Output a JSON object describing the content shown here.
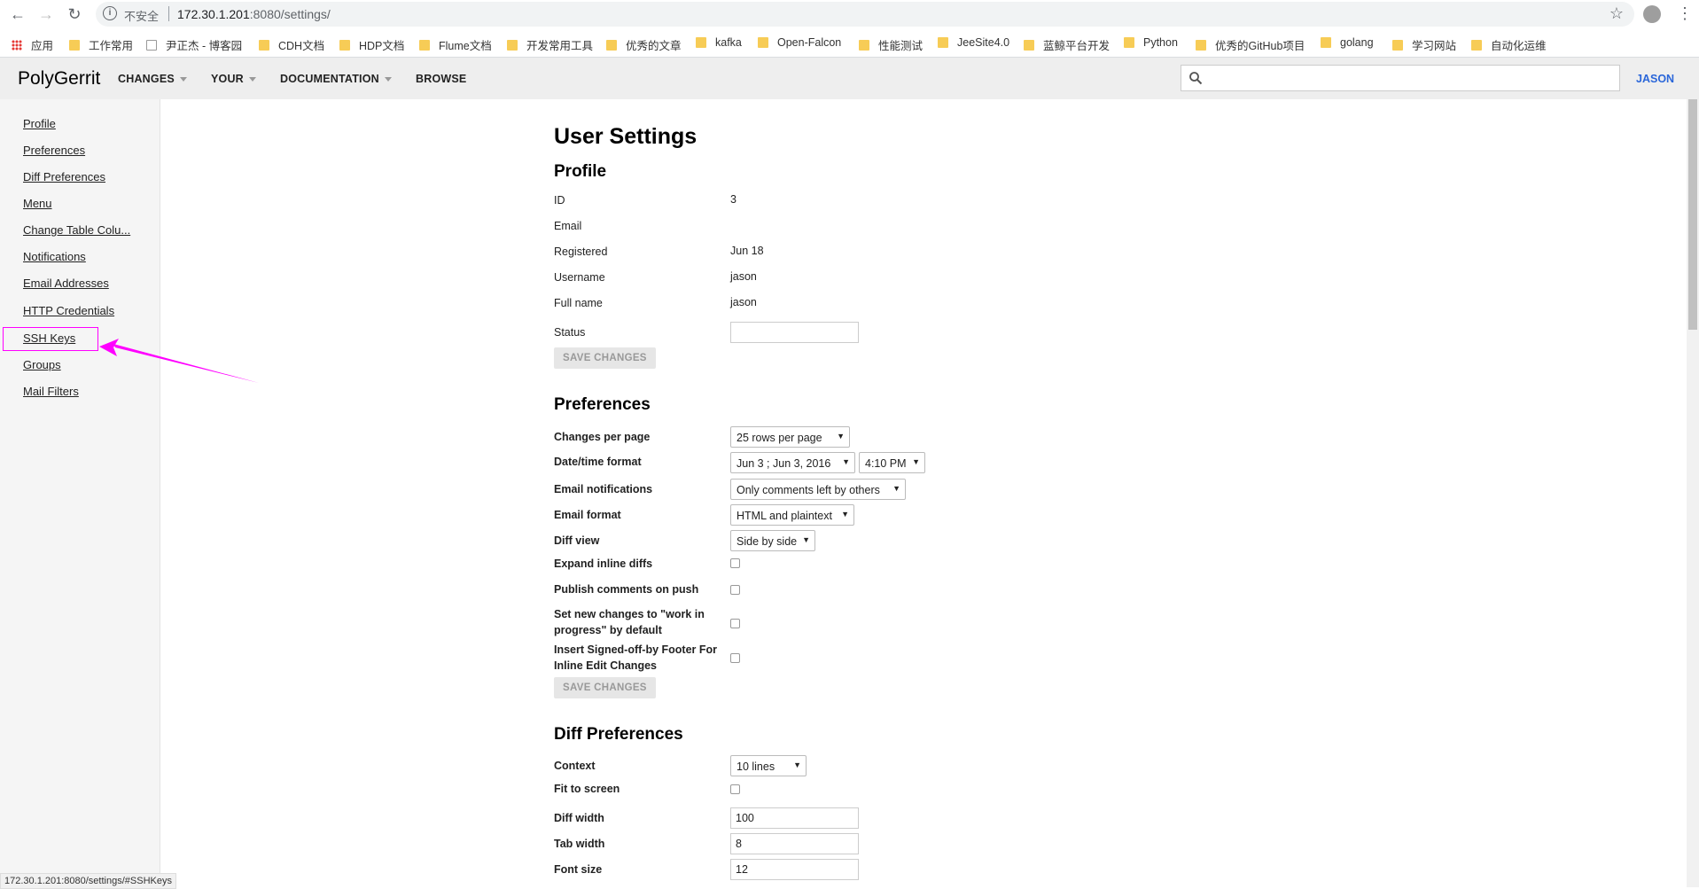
{
  "browser": {
    "security_label": "不安全",
    "url_host": "172.30.1.201",
    "url_rest": ":8080/settings/",
    "info_glyph": "i",
    "status_url": "172.30.1.201:8080/settings/#SSHKeys"
  },
  "bookmarks": [
    "应用",
    "工作常用",
    "尹正杰 - 博客园",
    "CDH文档",
    "HDP文档",
    "Flume文档",
    "开发常用工具",
    "优秀的文章",
    "kafka",
    "Open-Falcon",
    "性能测试",
    "JeeSite4.0",
    "蓝鲸平台开发",
    "Python",
    "优秀的GitHub项目",
    "golang",
    "学习网站",
    "自动化运维"
  ],
  "header": {
    "logo": "PolyGerrit",
    "nav": [
      "CHANGES",
      "YOUR",
      "DOCUMENTATION",
      "BROWSE"
    ],
    "user": "JASON"
  },
  "sidebar": {
    "items": [
      "Profile",
      "Preferences",
      "Diff Preferences",
      "Menu",
      "Change Table Colu...",
      "Notifications",
      "Email Addresses",
      "HTTP Credentials",
      "SSH Keys",
      "Groups",
      "Mail Filters"
    ]
  },
  "main": {
    "title": "User Settings",
    "profile": {
      "heading": "Profile",
      "fields": [
        {
          "label": "ID",
          "value": "3"
        },
        {
          "label": "Email",
          "value": ""
        },
        {
          "label": "Registered",
          "value": "Jun 18"
        },
        {
          "label": "Username",
          "value": "jason"
        },
        {
          "label": "Full name",
          "value": "jason"
        }
      ],
      "status_label": "Status",
      "status_value": "",
      "save_label": "SAVE CHANGES"
    },
    "preferences": {
      "heading": "Preferences",
      "changes_per_page": {
        "label": "Changes per page",
        "value": "25 rows per page"
      },
      "date_time": {
        "label": "Date/time format",
        "date_value": "Jun 3 ; Jun 3, 2016",
        "time_value": "4:10 PM"
      },
      "email_notifications": {
        "label": "Email notifications",
        "value": "Only comments left by others"
      },
      "email_format": {
        "label": "Email format",
        "value": "HTML and plaintext"
      },
      "diff_view": {
        "label": "Diff view",
        "value": "Side by side"
      },
      "expand_inline": "Expand inline diffs",
      "publish_on_push": "Publish comments on push",
      "wip_default": "Set new changes to \"work in progress\" by default",
      "signed_off": "Insert Signed-off-by Footer For Inline Edit Changes",
      "save_label": "SAVE CHANGES"
    },
    "diff_preferences": {
      "heading": "Diff Preferences",
      "context": {
        "label": "Context",
        "value": "10 lines"
      },
      "fit_to_screen": "Fit to screen",
      "diff_width": {
        "label": "Diff width",
        "value": "100"
      },
      "tab_width": {
        "label": "Tab width",
        "value": "8"
      },
      "font_size": {
        "label": "Font size",
        "value": "12"
      }
    }
  },
  "colors": {
    "accent": "#2a66d9",
    "highlight": "#ff00ff"
  }
}
